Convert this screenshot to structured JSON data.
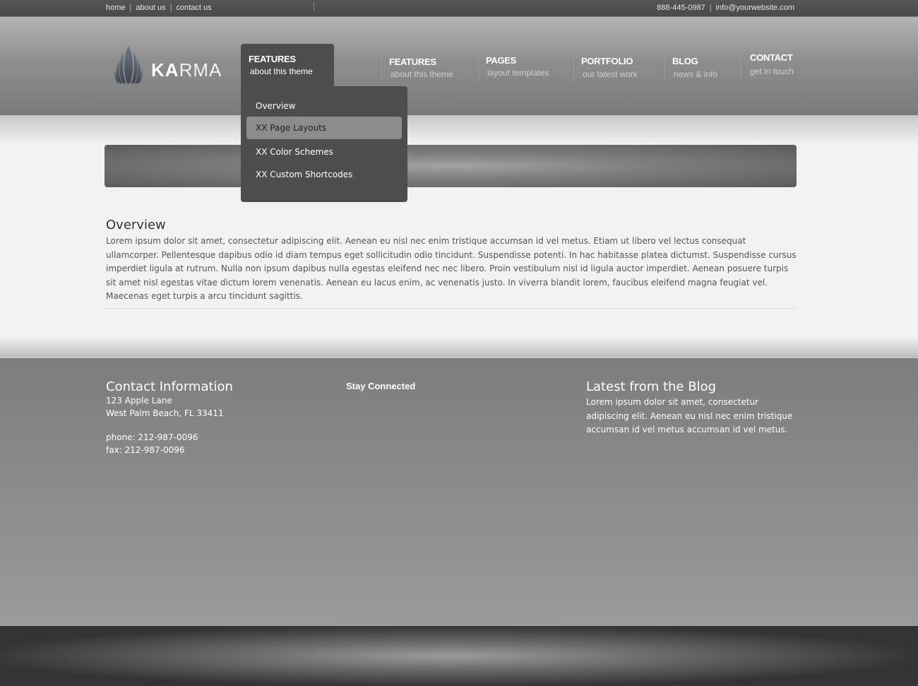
{
  "topbar": {
    "links": [
      "home",
      "about us",
      "contact us"
    ],
    "phone": "888-445-0987",
    "email": "info@yourwebsite.com",
    "separator": "|"
  },
  "logo": {
    "text_bold": "KA",
    "text_light": "RMA"
  },
  "nav": {
    "active": {
      "title": "FEATURES",
      "subtitle": "about this theme"
    },
    "items": [
      {
        "title": "FEATURES",
        "subtitle": "about this theme"
      },
      {
        "title": "PAGES",
        "subtitle": "layout templates"
      },
      {
        "title": "PORTFOLIO",
        "subtitle": "our latest work"
      },
      {
        "title": "BLOG",
        "subtitle": "news & info"
      },
      {
        "title": "CONTACT",
        "subtitle": "get in touch"
      }
    ]
  },
  "dropdown": {
    "items": [
      "Overview",
      "XX Page Layouts",
      "XX Color Schemes",
      "XX Custom Shortcodes"
    ]
  },
  "content": {
    "title": "Overview",
    "body": "Lorem ipsum dolor sit amet, consectetur adipiscing elit. Aenean eu nisl nec enim tristique accumsan id vel metus. Etiam ut libero vel lectus consequat ullamcorper. Pellentesque dapibus odio id diam tempus eget sollicitudin odio tincidunt. Suspendisse potenti. In hac habitasse platea dictumst. Suspendisse cursus imperdiet ligula at rutrum. Nulla non ipsum dapibus nulla egestas eleifend nec nec libero. Proin vestibulum nisl id ligula auctor imperdiet. Aenean posuere turpis sit amet nisl egestas vitae dictum lorem venenatis. Aenean eu lacus enim, ac venenatis justo. In viverra blandit lorem, faucibus eleifend magna feugiat vel. Maecenas eget turpis a arcu tincidunt sagittis."
  },
  "footer": {
    "contact": {
      "title": "Contact Information",
      "street": "123 Apple Lane",
      "city": "West Palm Beach, FL 33411",
      "phone": "phone: 212-987-0096",
      "fax": "fax: 212-987-0096"
    },
    "social": {
      "title": "Stay Connected"
    },
    "blog": {
      "title": "Latest from the Blog",
      "text": "Lorem ipsum dolor sit amet, consectetur adipiscing elit. Aenean eu nisl nec enim tristique accumsan id vel metus accumsan id vel metus."
    }
  }
}
